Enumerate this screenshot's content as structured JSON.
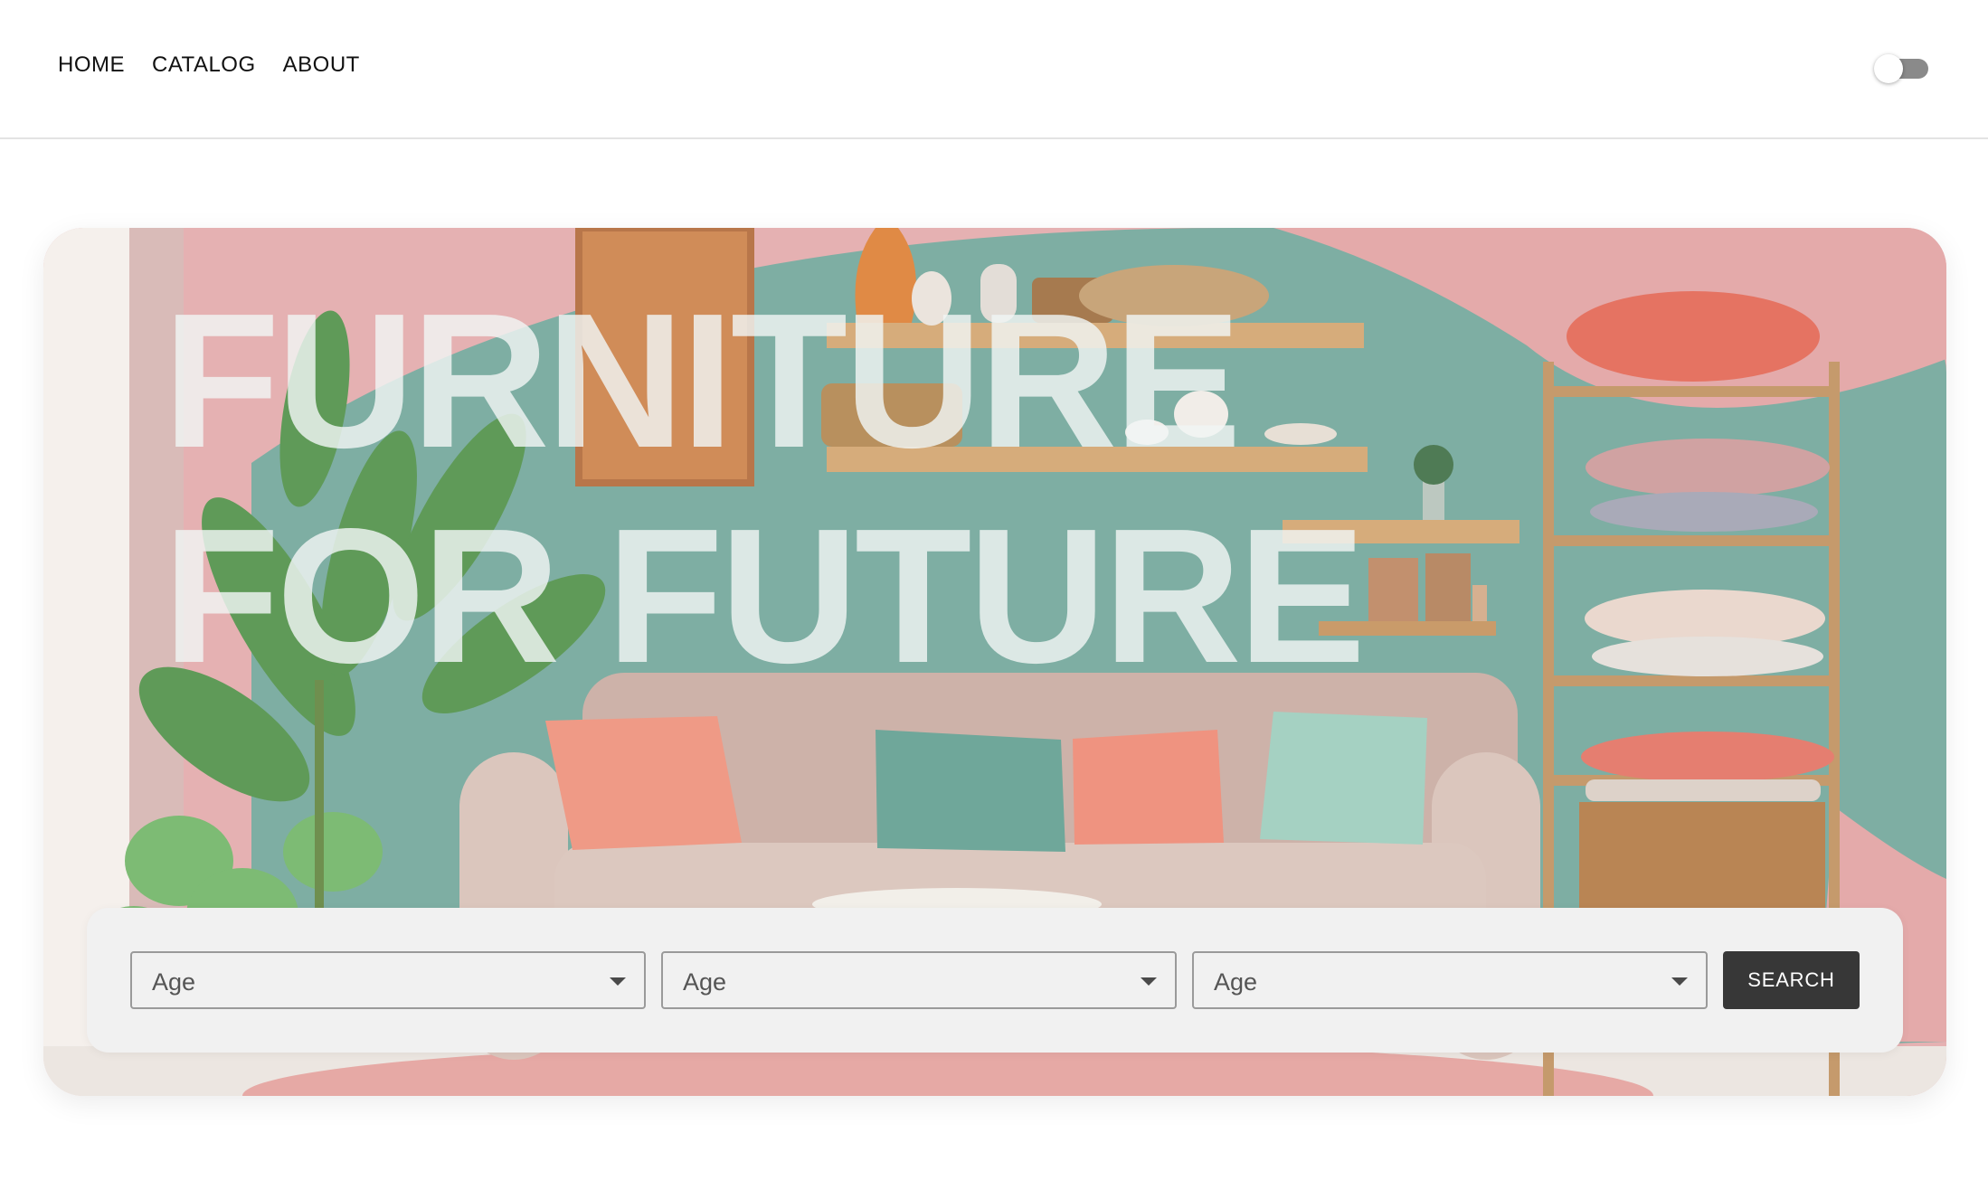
{
  "nav": {
    "items": [
      {
        "label": "HOME"
      },
      {
        "label": "CATALOG"
      },
      {
        "label": "ABOUT"
      }
    ]
  },
  "theme_toggle": {
    "state": "off"
  },
  "hero": {
    "title_line1": "FURNITURE",
    "title_line2": "FOR FUTURE"
  },
  "search": {
    "filters": [
      {
        "value": "Age"
      },
      {
        "value": "Age"
      },
      {
        "value": "Age"
      }
    ],
    "button_label": "SEARCH"
  },
  "colors": {
    "wall_teal": "#7fb0a5",
    "wall_pink": "#e3aaa9",
    "sofa": "#d8c0b6",
    "button_dark": "#373737",
    "panel": "#f1f1f1"
  }
}
